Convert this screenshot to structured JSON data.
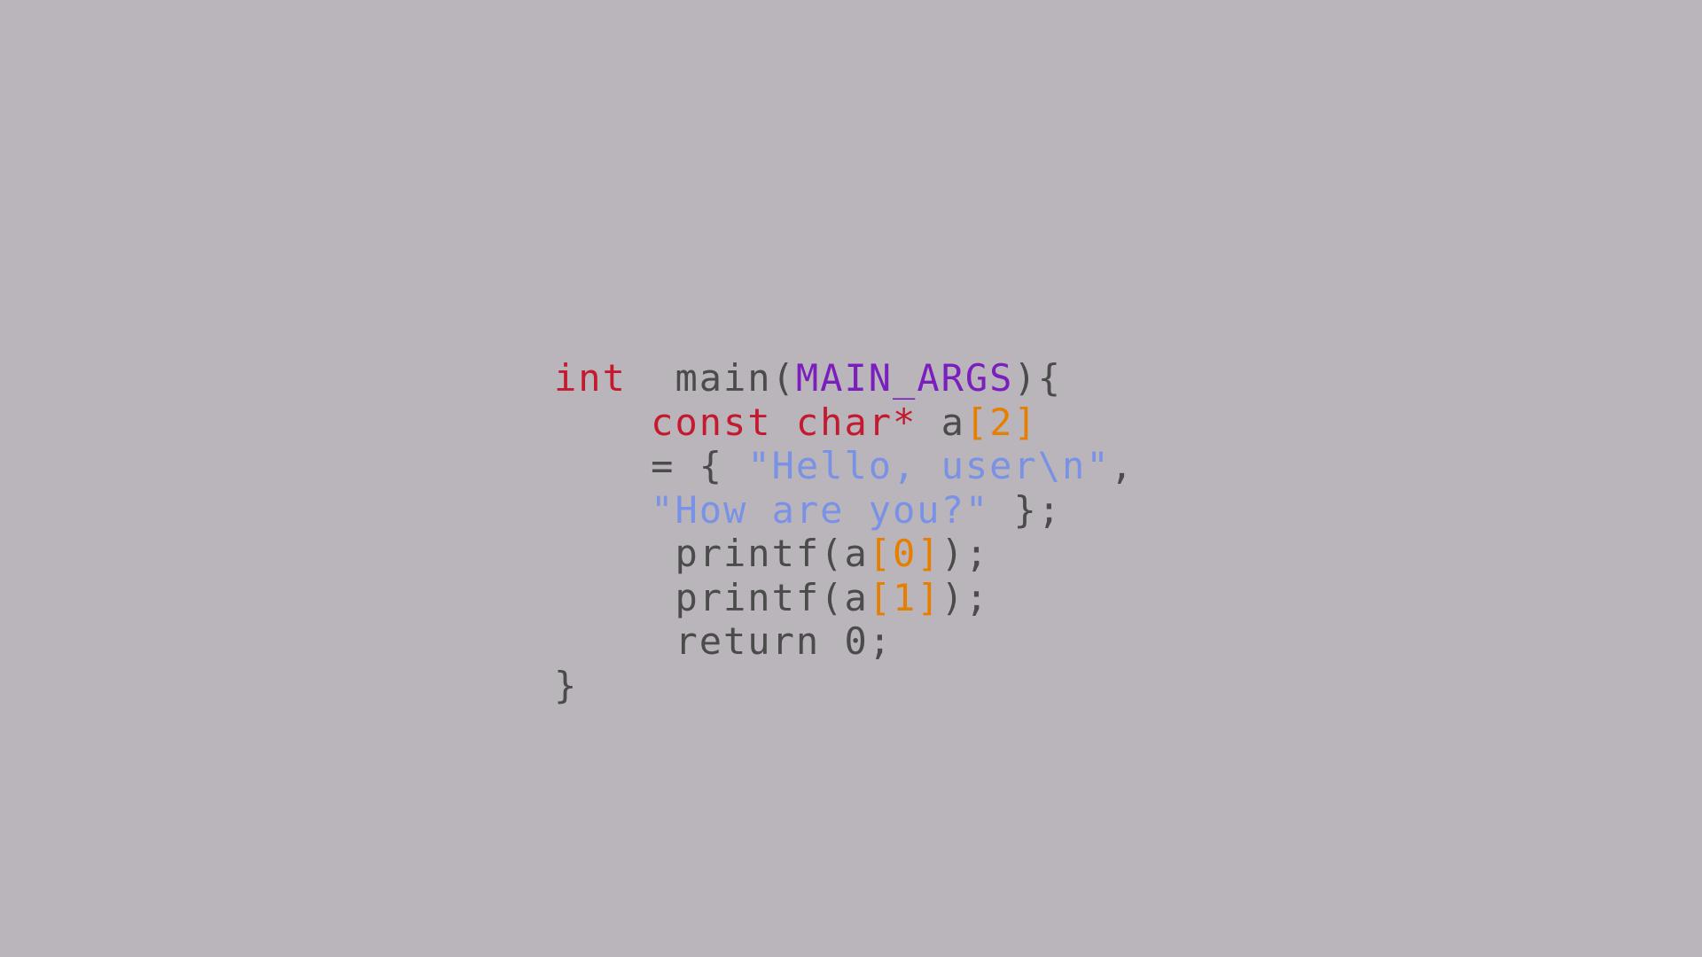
{
  "colors": {
    "background": "#bab5ba",
    "type_keyword": "#c41a30",
    "macro": "#7a1fbd",
    "plain": "#4b4b4b",
    "bracket_number": "#e67e00",
    "string": "#7a92e6"
  },
  "tokens": {
    "int": "int",
    "main": "main",
    "open_paren": "(",
    "main_args": "MAIN_ARGS",
    "close_paren_brace": "){",
    "const_char_star": "const char*",
    "var_a": " a",
    "lbracket": "[",
    "two": "2",
    "rbracket": "]",
    "eq_open": "= { ",
    "str1": "\"Hello, user\\n\"",
    "comma": ",",
    "str2": "\"How are you?\"",
    "close_init": " };",
    "printf_open": " printf(a",
    "zero": "0",
    "one": "1",
    "call_close": ");",
    "return_line": " return 0;",
    "close_brace": "}"
  }
}
